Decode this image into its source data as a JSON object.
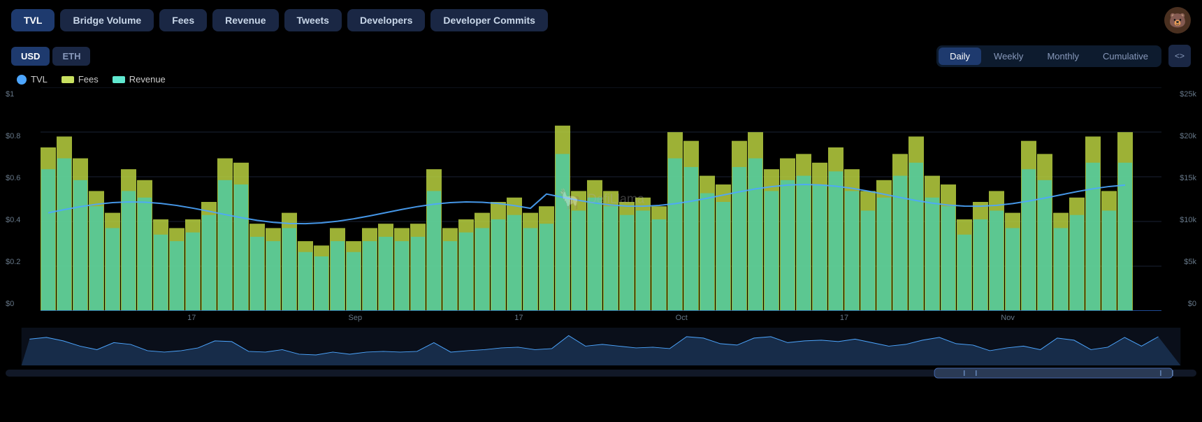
{
  "nav": {
    "buttons": [
      {
        "label": "TVL",
        "active": true
      },
      {
        "label": "Bridge Volume",
        "active": false
      },
      {
        "label": "Fees",
        "active": false
      },
      {
        "label": "Revenue",
        "active": false
      },
      {
        "label": "Tweets",
        "active": false
      },
      {
        "label": "Developers",
        "active": false
      },
      {
        "label": "Developer Commits",
        "active": false
      }
    ]
  },
  "currency": {
    "options": [
      {
        "label": "USD",
        "active": true
      },
      {
        "label": "ETH",
        "active": false
      }
    ]
  },
  "periods": {
    "options": [
      {
        "label": "Daily",
        "active": true
      },
      {
        "label": "Weekly",
        "active": false
      },
      {
        "label": "Monthly",
        "active": false
      },
      {
        "label": "Cumulative",
        "active": false
      }
    ]
  },
  "embed_btn_label": "<>",
  "legend": {
    "items": [
      {
        "key": "tvl",
        "label": "TVL",
        "type": "dot",
        "color": "#4da6ff"
      },
      {
        "key": "fees",
        "label": "Fees",
        "type": "rect",
        "color": "#c8e060"
      },
      {
        "key": "revenue",
        "label": "Revenue",
        "type": "rect",
        "color": "#60e8d0"
      }
    ]
  },
  "y_axis_left": [
    "$1",
    "$0.8",
    "$0.6",
    "$0.4",
    "$0.2",
    "$0"
  ],
  "y_axis_right": [
    "$25k",
    "$20k",
    "$15k",
    "$10k",
    "$5k",
    "$0"
  ],
  "x_axis": [
    "17",
    "Sep",
    "17",
    "Oct",
    "17",
    "Nov"
  ],
  "watermark": "DefiLlama",
  "chart": {
    "baseline": 280,
    "bars": [
      {
        "fees": 0.75,
        "revenue": 0.65
      },
      {
        "fees": 0.8,
        "revenue": 0.7
      },
      {
        "fees": 0.7,
        "revenue": 0.6
      },
      {
        "fees": 0.55,
        "revenue": 0.48
      },
      {
        "fees": 0.45,
        "revenue": 0.38
      },
      {
        "fees": 0.65,
        "revenue": 0.55
      },
      {
        "fees": 0.6,
        "revenue": 0.52
      },
      {
        "fees": 0.42,
        "revenue": 0.35
      },
      {
        "fees": 0.38,
        "revenue": 0.32
      },
      {
        "fees": 0.42,
        "revenue": 0.36
      },
      {
        "fees": 0.5,
        "revenue": 0.44
      },
      {
        "fees": 0.7,
        "revenue": 0.6
      },
      {
        "fees": 0.68,
        "revenue": 0.58
      },
      {
        "fees": 0.4,
        "revenue": 0.34
      },
      {
        "fees": 0.38,
        "revenue": 0.32
      },
      {
        "fees": 0.45,
        "revenue": 0.38
      },
      {
        "fees": 0.32,
        "revenue": 0.27
      },
      {
        "fees": 0.3,
        "revenue": 0.25
      },
      {
        "fees": 0.38,
        "revenue": 0.32
      },
      {
        "fees": 0.32,
        "revenue": 0.27
      },
      {
        "fees": 0.38,
        "revenue": 0.32
      },
      {
        "fees": 0.4,
        "revenue": 0.34
      },
      {
        "fees": 0.38,
        "revenue": 0.32
      },
      {
        "fees": 0.4,
        "revenue": 0.34
      },
      {
        "fees": 0.65,
        "revenue": 0.55
      },
      {
        "fees": 0.38,
        "revenue": 0.32
      },
      {
        "fees": 0.42,
        "revenue": 0.36
      },
      {
        "fees": 0.45,
        "revenue": 0.38
      },
      {
        "fees": 0.5,
        "revenue": 0.42
      },
      {
        "fees": 0.52,
        "revenue": 0.44
      },
      {
        "fees": 0.45,
        "revenue": 0.38
      },
      {
        "fees": 0.48,
        "revenue": 0.4
      },
      {
        "fees": 0.85,
        "revenue": 0.72
      },
      {
        "fees": 0.55,
        "revenue": 0.46
      },
      {
        "fees": 0.6,
        "revenue": 0.52
      },
      {
        "fees": 0.55,
        "revenue": 0.48
      },
      {
        "fees": 0.5,
        "revenue": 0.44
      },
      {
        "fees": 0.52,
        "revenue": 0.46
      },
      {
        "fees": 0.48,
        "revenue": 0.42
      },
      {
        "fees": 0.82,
        "revenue": 0.7
      },
      {
        "fees": 0.78,
        "revenue": 0.66
      },
      {
        "fees": 0.62,
        "revenue": 0.54
      },
      {
        "fees": 0.58,
        "revenue": 0.5
      },
      {
        "fees": 0.78,
        "revenue": 0.66
      },
      {
        "fees": 0.82,
        "revenue": 0.7
      },
      {
        "fees": 0.65,
        "revenue": 0.55
      },
      {
        "fees": 0.7,
        "revenue": 0.6
      },
      {
        "fees": 0.72,
        "revenue": 0.62
      },
      {
        "fees": 0.68,
        "revenue": 0.58
      },
      {
        "fees": 0.75,
        "revenue": 0.64
      },
      {
        "fees": 0.65,
        "revenue": 0.55
      },
      {
        "fees": 0.55,
        "revenue": 0.46
      },
      {
        "fees": 0.6,
        "revenue": 0.52
      },
      {
        "fees": 0.72,
        "revenue": 0.62
      },
      {
        "fees": 0.8,
        "revenue": 0.68
      },
      {
        "fees": 0.62,
        "revenue": 0.52
      },
      {
        "fees": 0.58,
        "revenue": 0.48
      },
      {
        "fees": 0.42,
        "revenue": 0.35
      },
      {
        "fees": 0.5,
        "revenue": 0.42
      },
      {
        "fees": 0.55,
        "revenue": 0.46
      },
      {
        "fees": 0.45,
        "revenue": 0.38
      },
      {
        "fees": 0.78,
        "revenue": 0.65
      },
      {
        "fees": 0.72,
        "revenue": 0.6
      },
      {
        "fees": 0.45,
        "revenue": 0.38
      },
      {
        "fees": 0.52,
        "revenue": 0.44
      },
      {
        "fees": 0.8,
        "revenue": 0.68
      },
      {
        "fees": 0.55,
        "revenue": 0.46
      },
      {
        "fees": 0.82,
        "revenue": 0.68
      }
    ]
  }
}
